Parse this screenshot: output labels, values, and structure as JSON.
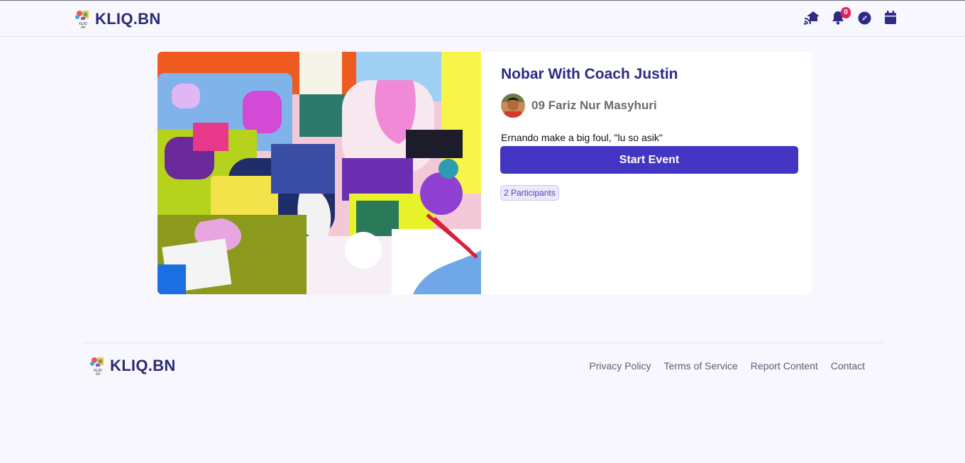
{
  "header": {
    "brand": "KLIQ.BN",
    "logo_small_text": "KLIQ.BN",
    "notifications_count": "0",
    "icons": [
      "feed-home-icon",
      "bell-icon",
      "compass-icon",
      "calendar-icon"
    ]
  },
  "event": {
    "title": "Nobar With Coach Justin",
    "host_name": "09 Fariz Nur Masyhuri",
    "description": "Ernando make a big foul, \"lu so asik\"",
    "start_label": "Start Event",
    "participants_label": "2 Participants"
  },
  "footer": {
    "brand": "KLIQ.BN",
    "links": [
      "Privacy Policy",
      "Terms of Service",
      "Report Content",
      "Contact"
    ]
  },
  "colors": {
    "primary": "#4335c4",
    "brand_text": "#2b2a72",
    "badge": "#e0245e",
    "background": "#f8f7fd"
  }
}
